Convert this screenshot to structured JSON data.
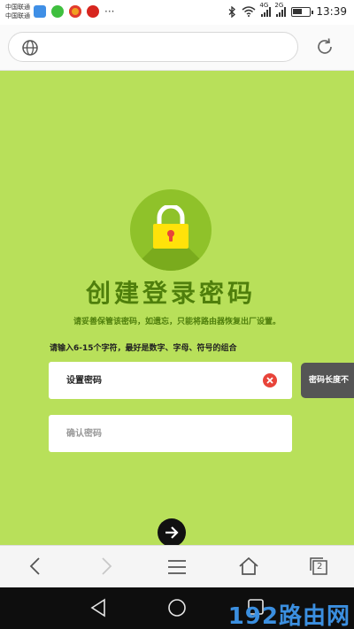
{
  "status_bar": {
    "carrier_1": "中国联通",
    "carrier_2": "中国联通",
    "more": "···",
    "network_1": "4G",
    "network_2": "2G",
    "time": "13:39",
    "battery_level": 0.6
  },
  "notification_icons": [
    "chat-icon",
    "wechat-icon",
    "weibo-icon",
    "netease-icon"
  ],
  "toolbar": {
    "address_value": "",
    "globe_icon": "globe-icon",
    "refresh_icon": "refresh-icon"
  },
  "content": {
    "title": "创建登录密码",
    "subtitle": "请妥善保管该密码，如遗忘，只能将路由器恢复出厂设置。",
    "hint": "请输入6-15个字符，最好是数字、字母、符号的组合",
    "password_placeholder": "设置密码",
    "confirm_placeholder": "确认密码",
    "tooltip": "密码长度不",
    "accent_color": "#4f7f0c",
    "background_color": "#b8e05a"
  },
  "bottom_toolbar": [
    "back-icon",
    "forward-icon",
    "menu-icon",
    "home-icon",
    "tabs-icon"
  ],
  "tabs_count": "2",
  "nav_bar": [
    "back-triangle-icon",
    "home-circle-icon",
    "recents-square-icon"
  ],
  "watermark": "192路由网"
}
